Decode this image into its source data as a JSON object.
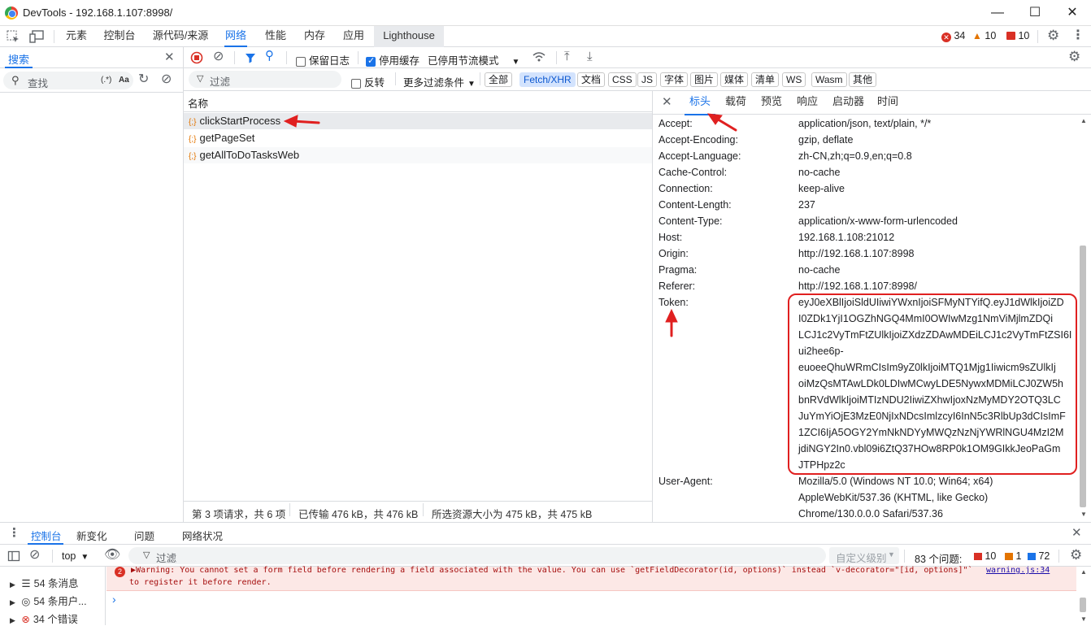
{
  "window": {
    "title": "DevTools - 192.168.1.107:8998/",
    "buttons": {
      "minimize": "—",
      "maximize": "☐",
      "close": "✕"
    }
  },
  "main_tabs": [
    "元素",
    "控制台",
    "源代码/来源",
    "网络",
    "性能",
    "内存",
    "应用",
    "Lighthouse"
  ],
  "active_main_tab": "网络",
  "status_counts": {
    "errors": "34",
    "warnings": "10",
    "issues": "10"
  },
  "search_panel": {
    "tab_label": "搜索",
    "input_placeholder": "查找",
    "regex_label": "(.*)",
    "case_label": "Aa"
  },
  "network_toolbar": {
    "preserve_log": "保留日志",
    "disable_cache": "停用缓存",
    "throttle": "已停用节流模式",
    "filter_placeholder": "过滤",
    "invert": "反转",
    "more_filters": "更多过滤条件",
    "chips": [
      "全部",
      "Fetch/XHR",
      "文档",
      "CSS",
      "JS",
      "字体",
      "图片",
      "媒体",
      "清单",
      "WS",
      "Wasm",
      "其他"
    ],
    "selected_chip": "Fetch/XHR"
  },
  "request_list": {
    "column_header": "名称",
    "items": [
      "clickStartProcess",
      "getPageSet",
      "getAllToDoTasksWeb"
    ],
    "summary": {
      "requests": "第 3 项请求，共 6 项",
      "transferred": "已传输 476 kB，共 476 kB",
      "resources": "所选资源大小为 475 kB，共 475 kB"
    }
  },
  "detail_tabs": [
    "标头",
    "载荷",
    "预览",
    "响应",
    "启动器",
    "时间"
  ],
  "active_detail_tab": "标头",
  "headers": [
    {
      "name": "Accept:",
      "value": "application/json, text/plain, */*"
    },
    {
      "name": "Accept-Encoding:",
      "value": "gzip, deflate"
    },
    {
      "name": "Accept-Language:",
      "value": "zh-CN,zh;q=0.9,en;q=0.8"
    },
    {
      "name": "Cache-Control:",
      "value": "no-cache"
    },
    {
      "name": "Connection:",
      "value": "keep-alive"
    },
    {
      "name": "Content-Length:",
      "value": "237"
    },
    {
      "name": "Content-Type:",
      "value": "application/x-www-form-urlencoded"
    },
    {
      "name": "Host:",
      "value": "192.168.1.108:21012"
    },
    {
      "name": "Origin:",
      "value": "http://192.168.1.107:8998"
    },
    {
      "name": "Pragma:",
      "value": "no-cache"
    },
    {
      "name": "Referer:",
      "value": "http://192.168.1.107:8998/"
    }
  ],
  "token": {
    "name": "Token:",
    "lines": [
      "eyJ0eXBlIjoiSldUIiwiYWxnIjoiSFMyNTYifQ.eyJ1dWlkIjoiZD",
      "I0ZDk1YjI1OGZhNGQ4MmI0OWIwMzg1NmViMjlmZDQi",
      "LCJ1c2VyTmFtZUlkIjoiZXdzZDAwMDEiLCJ1c2VyTmFtZSI6I",
      "ui2hee6p-",
      "euoeeQhuWRmCIsIm9yZ0lkIjoiMTQ1Mjg1Iiwicm9sZUlkIj",
      "oiMzQsMTAwLDk0LDIwMCwyLDE5NywxMDMiLCJ0ZW5h",
      "bnRVdWlkIjoiMTIzNDU2IiwiZXhwIjoxNzMyMDY2OTQ3LC",
      "JuYmYiOjE3MzE0NjIxNDcsImlzcyI6InN5c3RlbUp3dCIsImF",
      "1ZCI6IjA5OGY2YmNkNDYyMWQzNzNjYWRlNGU4MzI2M",
      "jdiNGY2In0.vbl09i6ZtQ37HOw8RP0k1OM9GIkkJeoPaGm",
      "JTPHpz2c"
    ]
  },
  "user_agent": {
    "name": "User-Agent:",
    "lines": [
      "Mozilla/5.0 (Windows NT 10.0; Win64; x64)",
      "AppleWebKit/537.36 (KHTML, like Gecko)",
      "Chrome/130.0.0.0 Safari/537.36"
    ]
  },
  "drawer": {
    "tabs": [
      "控制台",
      "新变化",
      "问题",
      "网络状况"
    ],
    "active_tab": "控制台",
    "context": "top",
    "filter_placeholder": "过滤",
    "level": "自定义级别",
    "issues_label": "83 个问题:",
    "issue_counts": {
      "errors": "10",
      "warnings": "1",
      "info": "72"
    },
    "sidebar": [
      "54 条消息",
      "54 条用户...",
      "34 个错误"
    ],
    "warning_count": "2",
    "warning_text": "▶Warning: You cannot set a form field before rendering a field associated with the value. You can use `getFieldDecorator(id, options)` instead `v-decorator=\"[id, options]\"`",
    "warning_text2": "to register it before render.",
    "warning_link": "warning.js:34",
    "prompt": "›"
  },
  "accent_color": "#1a73e8",
  "annotation_color": "#e02020"
}
